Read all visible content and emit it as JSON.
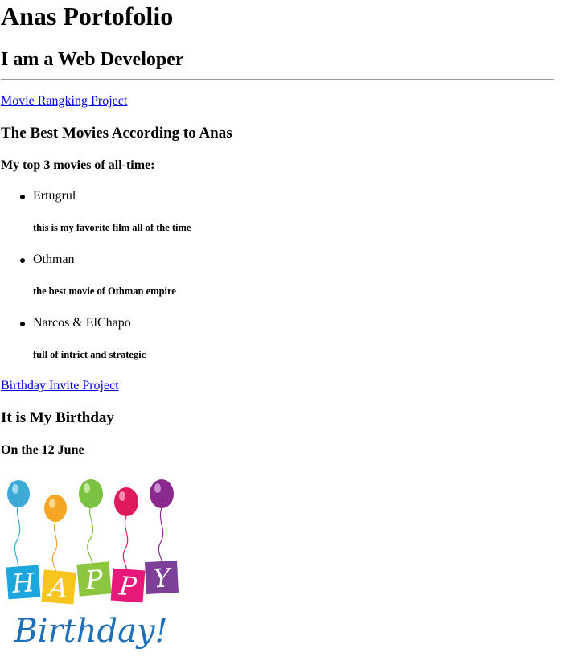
{
  "header": {
    "title": "Anas Portofolio",
    "subtitle": "I am a Web Developer"
  },
  "movies_section": {
    "link": "Movie Rangking Project",
    "heading": "The Best Movies According to Anas",
    "subheading": "My top 3 movies of all-time:",
    "items": [
      {
        "name": "Ertugrul",
        "desc": "this is my favorite film all of the time"
      },
      {
        "name": "Othman",
        "desc": "the best movie of Othman empire"
      },
      {
        "name": "Narcos & ElChapo",
        "desc": "full of intrict and strategic"
      }
    ]
  },
  "birthday_section": {
    "link": "Birthday Invite Project",
    "heading": "It is My Birthday",
    "date": "On the 12 June",
    "image": {
      "banner_letters": [
        "H",
        "A",
        "P",
        "P",
        "Y"
      ],
      "script_text": "Birthday!"
    }
  },
  "colors": {
    "link": "#0000ee",
    "balloons": [
      "#3fa9d6",
      "#f5a623",
      "#7cc242",
      "#e0195c",
      "#8a2a8f"
    ],
    "banner": [
      "#1ba6dd",
      "#f7c51e",
      "#8cc63e",
      "#e8177a",
      "#7e3f98"
    ],
    "script": "#1e6fb8"
  }
}
